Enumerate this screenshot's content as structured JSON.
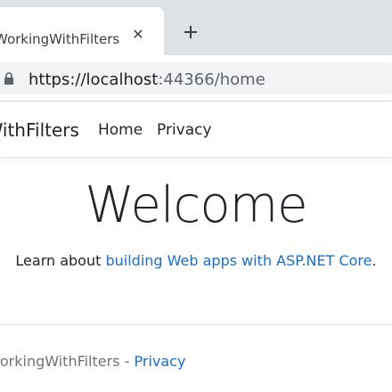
{
  "browser": {
    "tab_title": "WorkingWithFilters",
    "close_glyph": "✕",
    "url_host": "https://localhost",
    "url_rest": ":44366/home",
    "icons": [
      "close-icon",
      "plus-icon",
      "lock-icon"
    ]
  },
  "navbar": {
    "brand": "WorkingWithFilters",
    "links": [
      "Home",
      "Privacy"
    ]
  },
  "main": {
    "heading": "Welcome",
    "lead_prefix": "Learn about ",
    "lead_link": "building Web apps with ASP.NET Core",
    "lead_suffix": "."
  },
  "footer": {
    "brand": "WorkingWithFilters",
    "separator": " - ",
    "link": "Privacy"
  },
  "colors": {
    "link": "#1b6ec2",
    "tabstrip": "#dee1e6",
    "omnibox": "#f1f3f4",
    "muted": "#6c757d"
  }
}
